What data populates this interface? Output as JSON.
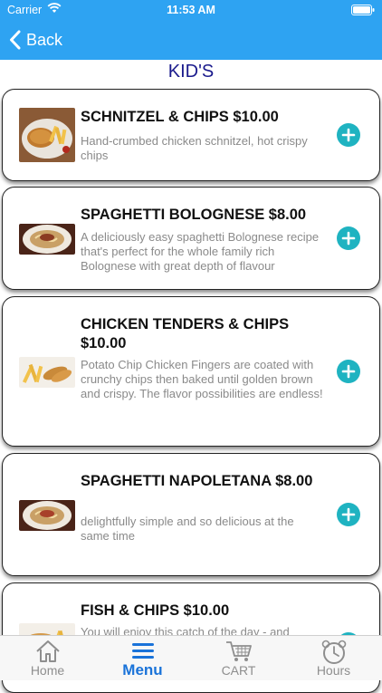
{
  "status_bar": {
    "carrier": "Carrier",
    "time": "11:53 AM"
  },
  "nav": {
    "back_label": "Back"
  },
  "page": {
    "title": "KID'S"
  },
  "menu_items": [
    {
      "title": "SCHNITZEL & CHIPS $10.00",
      "description": "Hand-crumbed chicken schnitzel, hot crispy chips"
    },
    {
      "title": "SPAGHETTI BOLOGNESE $8.00",
      "description": "A deliciously easy spaghetti Bolognese recipe that's perfect for the whole family rich Bolognese with great depth of flavour"
    },
    {
      "title": "CHICKEN TENDERS & CHIPS $10.00",
      "description": "Potato Chip Chicken Fingers are coated with crunchy chips then baked until golden brown and crispy. The flavor possibilities are endless!"
    },
    {
      "title": "SPAGHETTI NAPOLETANA $8.00",
      "description": "delightfully simple and so delicious at the same time"
    },
    {
      "title": "FISH & CHIPS $10.00",
      "description": "You will enjoy this catch of the day - and"
    }
  ],
  "tabs": [
    {
      "label": "Home",
      "icon": "home-icon"
    },
    {
      "label": "Menu",
      "icon": "menu-icon"
    },
    {
      "label": "CART",
      "icon": "cart-icon"
    },
    {
      "label": "Hours",
      "icon": "clock-icon"
    }
  ],
  "colors": {
    "header": "#2ea3f2",
    "add_button": "#1fb3c1",
    "active_tab": "#1a73d9",
    "title": "#1a1a8c"
  }
}
